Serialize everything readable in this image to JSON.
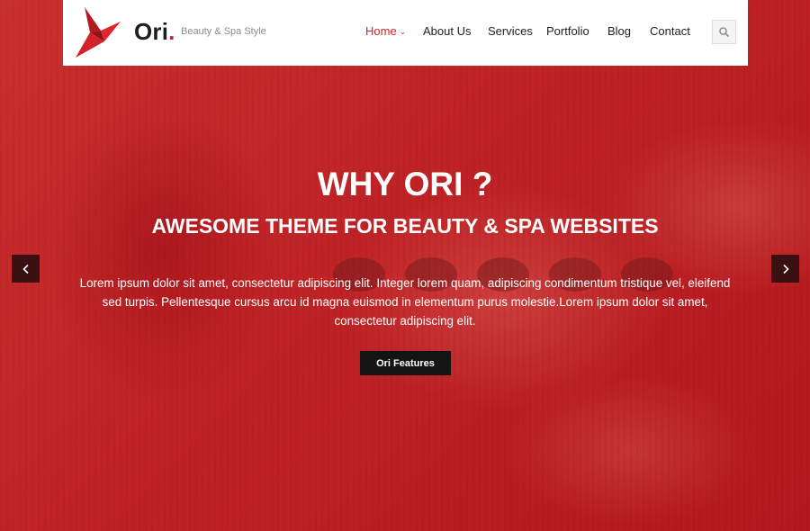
{
  "brand": {
    "name": "Ori",
    "dot": ".",
    "tagline": "Beauty & Spa Style",
    "accent_color": "#d0232a"
  },
  "nav": {
    "items": [
      {
        "label": "Home",
        "active": true,
        "has_dropdown": true
      },
      {
        "label": "About Us",
        "active": false
      },
      {
        "label": "Services",
        "active": false
      },
      {
        "label": "Portfolio",
        "active": false
      },
      {
        "label": "Blog",
        "active": false
      },
      {
        "label": "Contact",
        "active": false
      }
    ],
    "search_icon": "search-icon"
  },
  "hero": {
    "title": "WHY ORI ?",
    "subtitle": "AWESOME THEME FOR BEAUTY & SPA WEBSITES",
    "body_lines": [
      "Lorem ipsum dolor sit amet, consectetur adipiscing elit. Integer lorem quam, adipiscing condimentum tristique vel, eleifend",
      "sed turpis. Pellentesque cursus arcu id magna euismod in elementum purus molestie.Lorem ipsum dolor sit amet,",
      "consectetur adipiscing elit."
    ],
    "cta_label": "Ori Features",
    "prev_icon": "chevron-left-icon",
    "next_icon": "chevron-right-icon"
  }
}
